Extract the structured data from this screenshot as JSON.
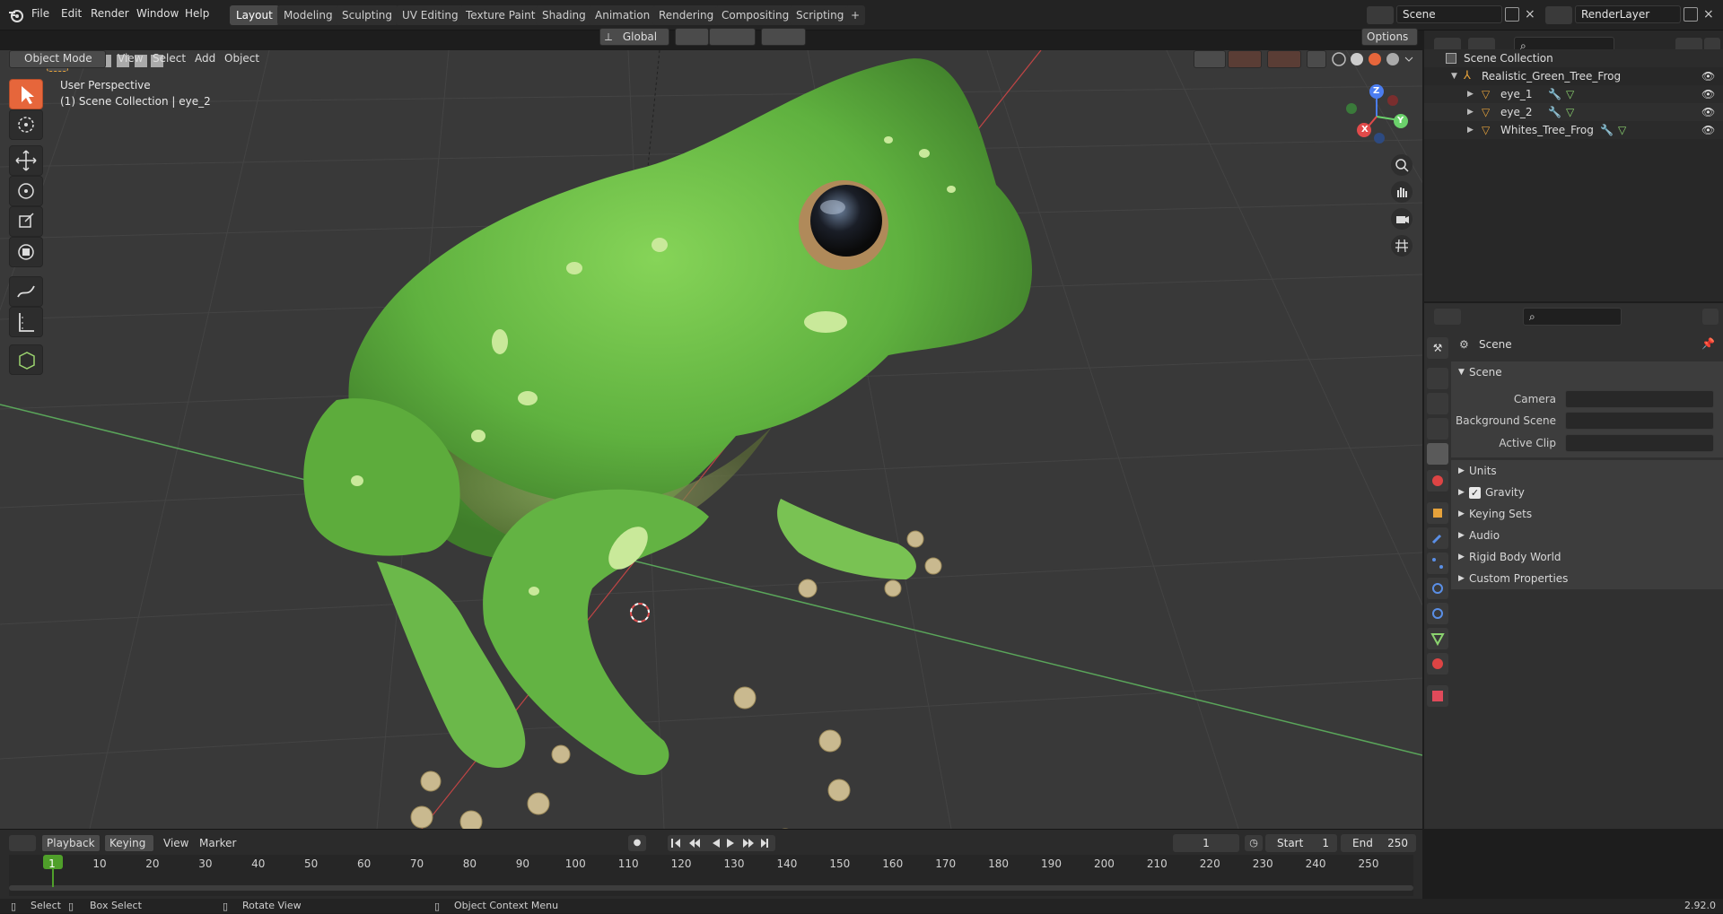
{
  "app": {
    "version": "2.92.0"
  },
  "menu": [
    "File",
    "Edit",
    "Render",
    "Window",
    "Help"
  ],
  "workspaces": [
    {
      "label": "Layout",
      "active": true
    },
    {
      "label": "Modeling"
    },
    {
      "label": "Sculpting"
    },
    {
      "label": "UV Editing"
    },
    {
      "label": "Texture Paint"
    },
    {
      "label": "Shading"
    },
    {
      "label": "Animation"
    },
    {
      "label": "Rendering"
    },
    {
      "label": "Compositing"
    },
    {
      "label": "Scripting"
    }
  ],
  "scene_selector": "Scene",
  "view_layer": "RenderLayer",
  "viewport": {
    "mode": "Object Mode",
    "menus": [
      "View",
      "Select",
      "Add",
      "Object"
    ],
    "orientation": "Global",
    "options": "Options",
    "overlay_text_1": "User Perspective",
    "overlay_text_2": "(1) Scene Collection | eye_2",
    "gizmo_axes": {
      "x": "X",
      "y": "Y",
      "z": "Z"
    }
  },
  "outliner": {
    "root": "Scene Collection",
    "items": [
      {
        "name": "Realistic_Green_Tree_Frog",
        "level": 1
      },
      {
        "name": "eye_1",
        "level": 2
      },
      {
        "name": "eye_2",
        "level": 2
      },
      {
        "name": "Whites_Tree_Frog",
        "level": 2
      }
    ]
  },
  "properties": {
    "breadcrumb": "Scene",
    "panel_title": "Scene",
    "fields": [
      {
        "label": "Camera",
        "value": ""
      },
      {
        "label": "Background Scene",
        "value": ""
      },
      {
        "label": "Active Clip",
        "value": ""
      }
    ],
    "subpanels": [
      "Units",
      "Gravity",
      "Keying Sets",
      "Audio",
      "Rigid Body World",
      "Custom Properties"
    ],
    "gravity_checked": true
  },
  "timeline": {
    "menus": [
      "Playback",
      "Keying",
      "View",
      "Marker"
    ],
    "current_frame": "1",
    "start_label": "Start",
    "start": "1",
    "end_label": "End",
    "end": "250",
    "ticks": [
      "1",
      "10",
      "20",
      "30",
      "40",
      "50",
      "60",
      "70",
      "80",
      "90",
      "100",
      "110",
      "120",
      "130",
      "140",
      "150",
      "160",
      "170",
      "180",
      "190",
      "200",
      "210",
      "220",
      "230",
      "240",
      "250"
    ]
  },
  "status": {
    "select": "Select",
    "box_select": "Box Select",
    "rotate": "Rotate View",
    "context_menu": "Object Context Menu"
  },
  "colors": {
    "accent": "#e6663b",
    "x_axis": "#e14a4a",
    "y_axis": "#6bd16b",
    "z_axis": "#4b7df0",
    "frog_green": "#6cc04a"
  }
}
